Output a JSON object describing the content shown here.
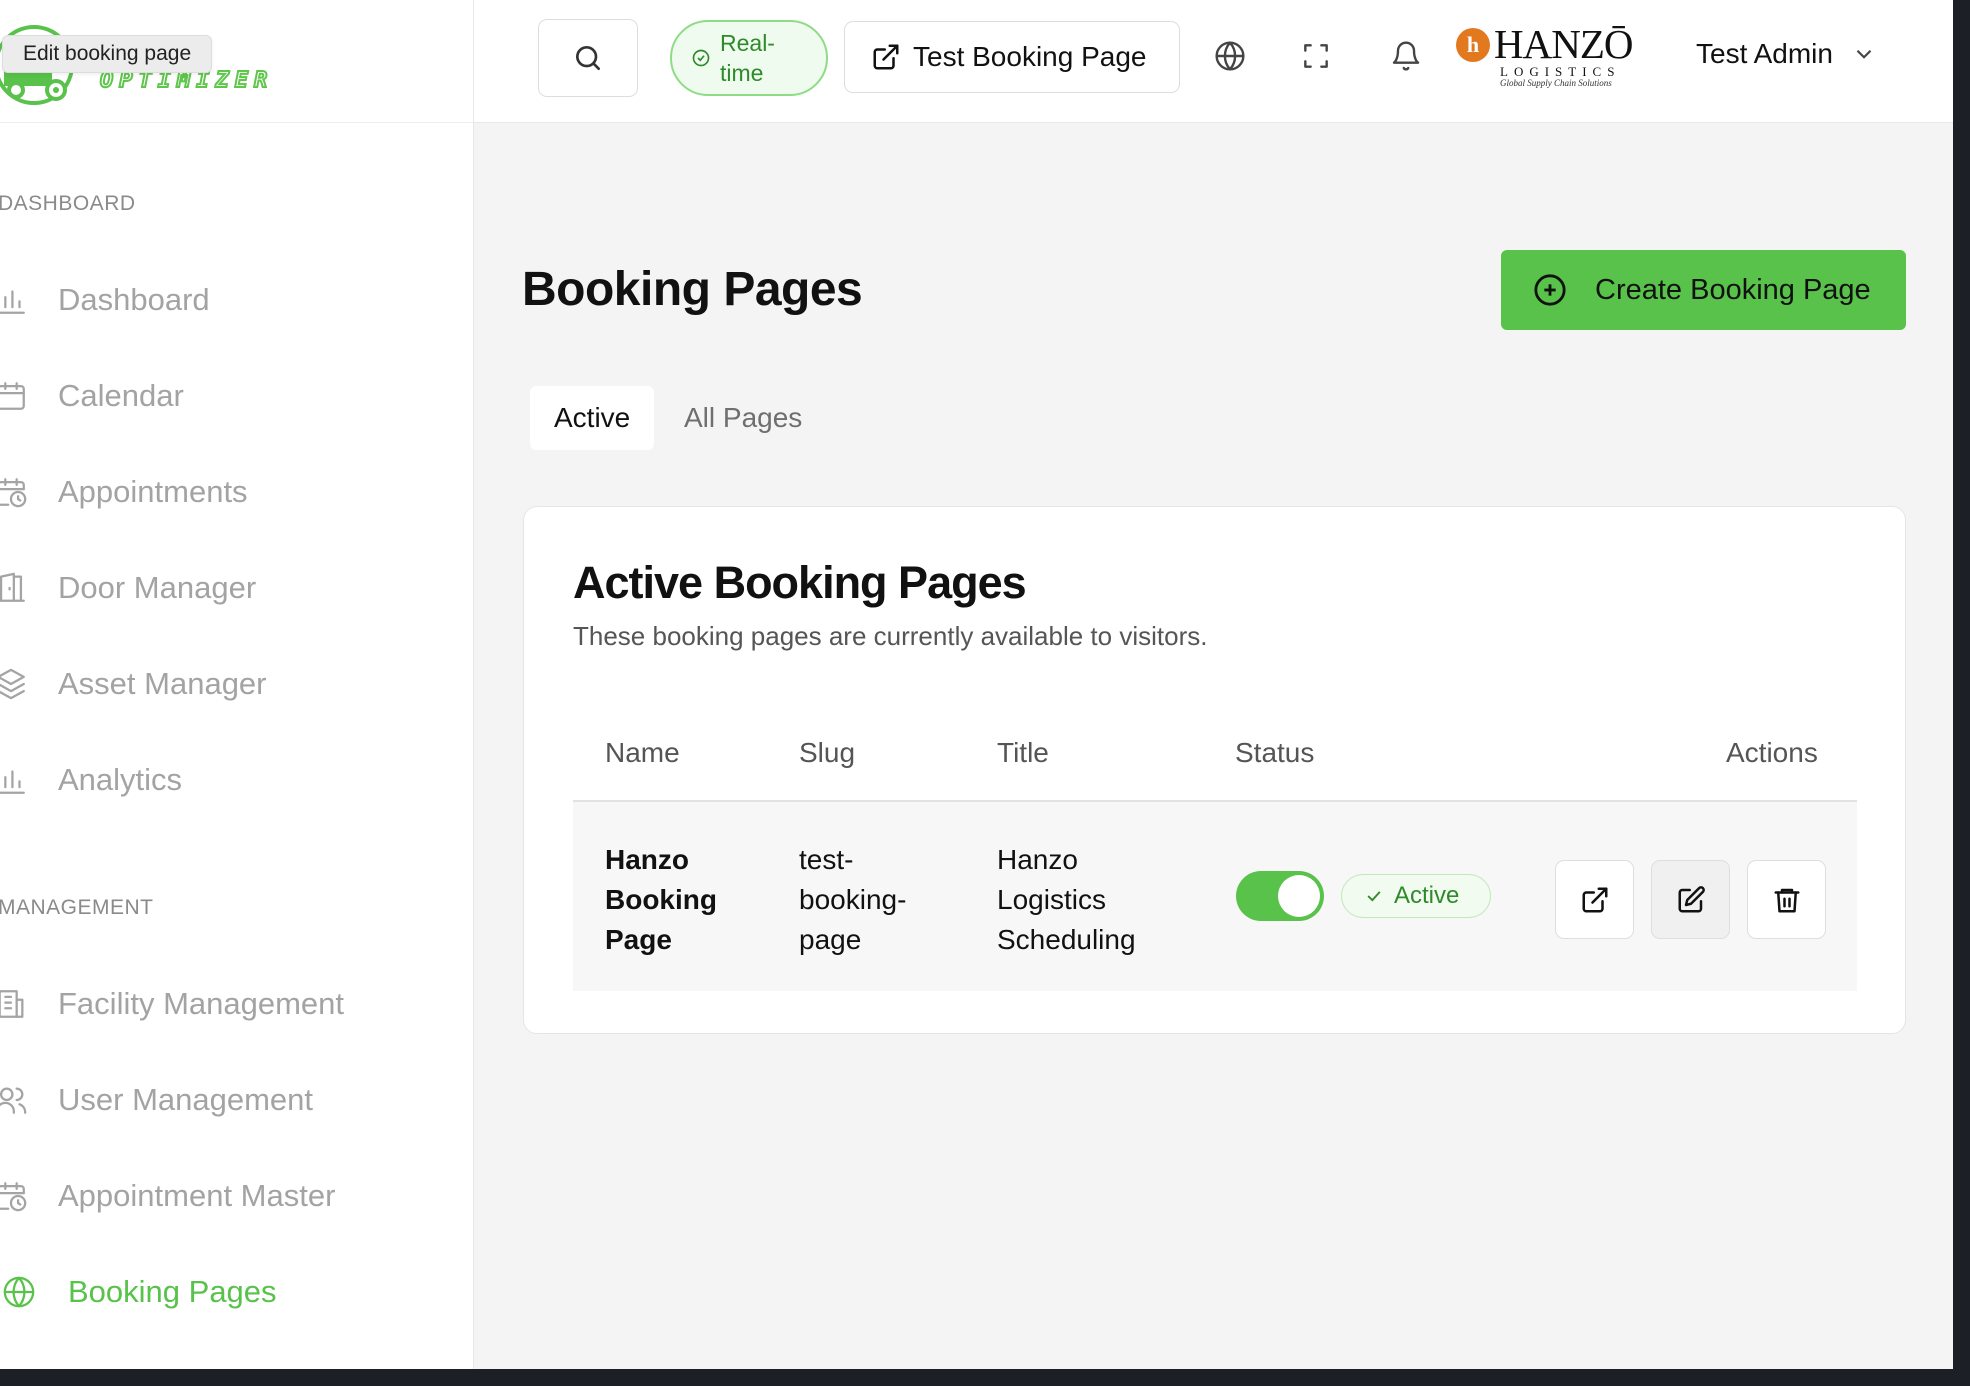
{
  "tooltip": "Edit booking page",
  "logo": {
    "text": "OPTIMIZER",
    "accent": "#58c24a"
  },
  "sidebar": {
    "sections": [
      {
        "label": "DASHBOARD"
      },
      {
        "label": "MANAGEMENT"
      }
    ],
    "items": [
      {
        "label": "Dashboard",
        "icon": "bar-chart-icon"
      },
      {
        "label": "Calendar",
        "icon": "calendar-icon"
      },
      {
        "label": "Appointments",
        "icon": "calendar-clock-icon"
      },
      {
        "label": "Door Manager",
        "icon": "door-icon"
      },
      {
        "label": "Asset Manager",
        "icon": "boxes-icon"
      },
      {
        "label": "Analytics",
        "icon": "bar-chart-icon"
      },
      {
        "label": "Facility Management",
        "icon": "building-icon"
      },
      {
        "label": "User Management",
        "icon": "users-icon"
      },
      {
        "label": "Appointment Master",
        "icon": "calendar-clock-icon"
      },
      {
        "label": "Booking Pages",
        "icon": "globe-icon",
        "active": true
      }
    ]
  },
  "topbar": {
    "realtime_label": "Real-time",
    "test_booking_label": "Test Booking Page",
    "brand": {
      "name": "HANZŌ",
      "sub": "LOGISTICS",
      "tagline": "Global Supply Chain Solutions",
      "mark": "h"
    },
    "user_name": "Test Admin"
  },
  "main": {
    "title": "Booking Pages",
    "create_label": "Create Booking Page",
    "tabs": [
      {
        "label": "Active",
        "active": true
      },
      {
        "label": "All Pages",
        "active": false
      }
    ],
    "card": {
      "title": "Active Booking Pages",
      "subtitle": "These booking pages are currently available to visitors.",
      "columns": [
        "Name",
        "Slug",
        "Title",
        "Status",
        "Actions"
      ],
      "rows": [
        {
          "name": "Hanzo Booking Page",
          "slug": "test-booking-page",
          "title": "Hanzo Logistics Scheduling",
          "enabled": true,
          "status": "Active"
        }
      ]
    }
  },
  "colors": {
    "primary": "#58c24a",
    "status_text": "#2e8a2a"
  }
}
